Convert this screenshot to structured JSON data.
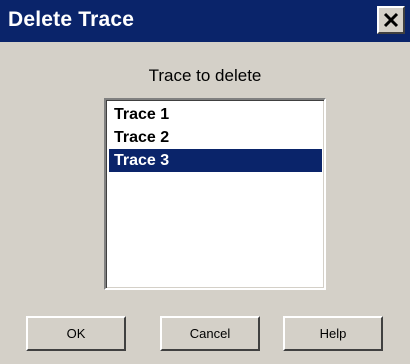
{
  "dialog": {
    "title": "Delete Trace"
  },
  "trace_list": {
    "label": "Trace to delete",
    "items": [
      {
        "label": "Trace 1",
        "selected": false
      },
      {
        "label": "Trace 2",
        "selected": false
      },
      {
        "label": "Trace 3",
        "selected": true
      }
    ]
  },
  "buttons": {
    "ok": "OK",
    "cancel": "Cancel",
    "help": "Help"
  },
  "icons": {
    "close": "close-icon"
  },
  "colors": {
    "titlebar": "#0a246a",
    "selection": "#0a246a",
    "face": "#d4d0c8"
  }
}
